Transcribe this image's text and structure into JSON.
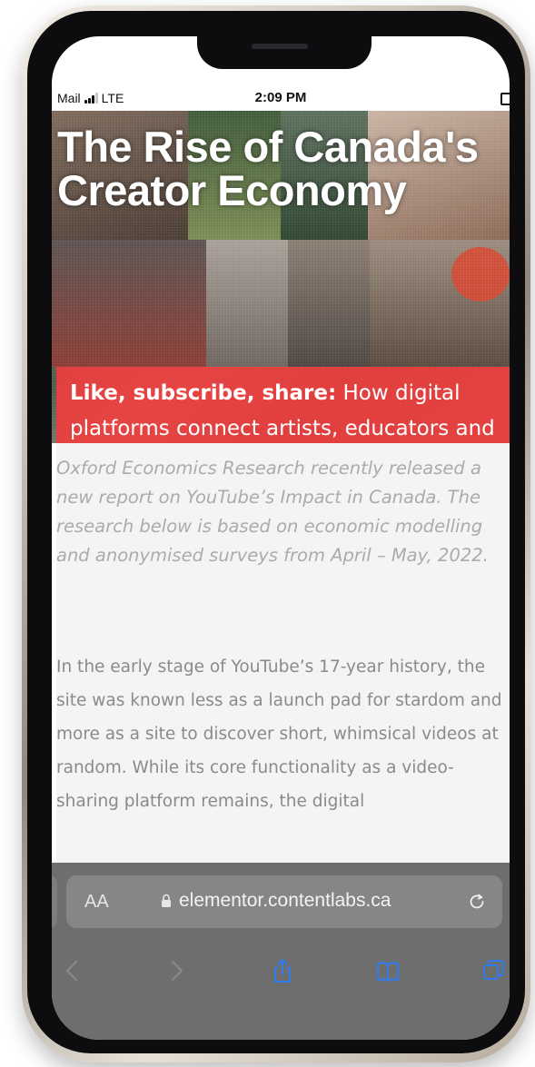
{
  "status_bar": {
    "carrier": "Mail",
    "network": "LTE",
    "time": "2:09 PM"
  },
  "article": {
    "title": "The Rise of Canada's Creator Economy",
    "subtitle_bold": "Like, subscribe, share:",
    "subtitle_rest": "How digital platforms connect artists, educators and influencers alike to their entrepreneurial spirit",
    "intro": "Oxford Economics Research recently released a new report on YouTube’s Impact in Canada. The research below is based on economic modelling and anonymised surveys from April – May, 2022.",
    "body": "In the early stage of YouTube’s 17-year history, the site was known less as a launch pad for stardom and more as a site to discover short, whimsical videos at random. While its core functionality as a video-sharing platform remains, the digital"
  },
  "browser": {
    "text_size_label": "AA",
    "url": "elementor.contentlabs.ca"
  },
  "icons": {
    "back": "chevron-left-icon",
    "forward": "chevron-right-icon",
    "share": "share-icon",
    "bookmarks": "book-icon",
    "tabs": "tabs-icon",
    "reload": "reload-icon",
    "lock": "lock-icon"
  },
  "colors": {
    "accent_red": "#ec3e3e",
    "safari_blue": "#2f7bf0",
    "bar_gray": "#6e6e6e"
  }
}
